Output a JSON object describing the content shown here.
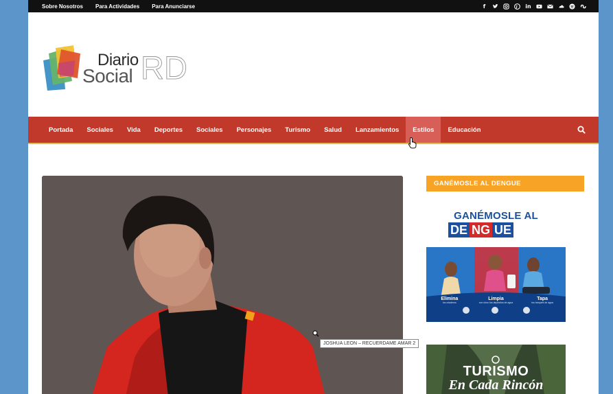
{
  "topbar": {
    "links": [
      "Sobre Nosotros",
      "Para Actividades",
      "Para Anunciarse"
    ],
    "social_icons": [
      "facebook-icon",
      "twitter-icon",
      "instagram-icon",
      "pinterest-icon",
      "linkedin-icon",
      "youtube-icon",
      "email-icon",
      "soundcloud-icon",
      "spotify-icon",
      "stumbleupon-icon"
    ]
  },
  "logo": {
    "word1": "Diario",
    "word2": "Social",
    "word3": "RD"
  },
  "nav": {
    "items": [
      "Portada",
      "Sociales",
      "Vida",
      "Deportes",
      "Sociales",
      "Personajes",
      "Turismo",
      "Salud",
      "Lanzamientos",
      "Estilos",
      "Educación"
    ],
    "active_index": 9
  },
  "hero": {
    "tooltip": "JOSHUA LEON – RECUERDAME AMAR 2"
  },
  "sidebar": {
    "widget_title": "GANÉMOSLE AL DENGUE",
    "ad1": {
      "headline": "GANÉMOSLE AL",
      "dengue_letters": [
        "DE",
        "NG",
        "UE"
      ],
      "steps": [
        {
          "label": "Elimina",
          "sub": "los criaderos"
        },
        {
          "label": "Limpia",
          "sub": "con cloro tus depósitos de agua"
        },
        {
          "label": "Tapa",
          "sub": "tus tanques de agua"
        }
      ]
    },
    "ad2": {
      "line1": "TURISMO",
      "line2": "En Cada Rincón"
    }
  },
  "colors": {
    "nav_red": "#c0392b",
    "active_tab": "#d85e58",
    "orange_widget": "#f7a325",
    "topbar": "#111111",
    "frame_blue": "#5b95c9"
  }
}
